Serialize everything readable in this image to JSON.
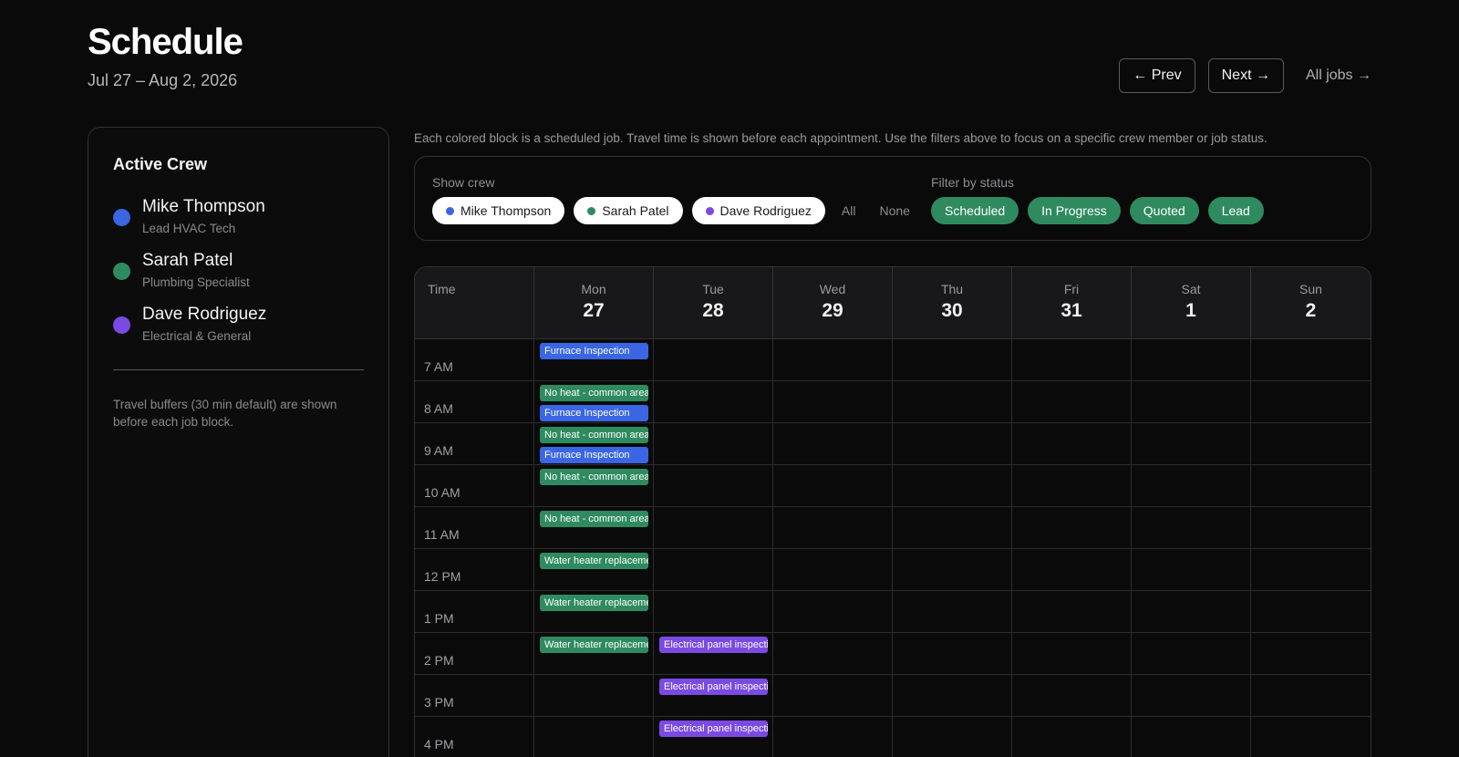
{
  "header": {
    "title": "Schedule",
    "subtitle": "Jul 27 – Aug 2, 2026",
    "prev_label": "← Prev",
    "next_label": "Next →",
    "all_jobs_label": "All jobs →"
  },
  "crew_panel": {
    "title": "Active Crew",
    "members": [
      {
        "name": "Mike Thompson",
        "role": "Lead HVAC Tech",
        "color": "#3a66e3"
      },
      {
        "name": "Sarah Patel",
        "role": "Plumbing Specialist",
        "color": "#2f8b5f"
      },
      {
        "name": "Dave Rodriguez",
        "role": "Electrical & General",
        "color": "#7a4ae2"
      }
    ],
    "note": "Travel buffers (30 min default) are shown before each job block."
  },
  "help_text": "Each colored block is a scheduled job. Travel time is shown before each appointment. Use the filters above to focus on a specific crew member or job status.",
  "filters": {
    "crew_label": "Show crew",
    "crew_pills": [
      {
        "label": "Mike Thompson",
        "color": "#3a66e3"
      },
      {
        "label": "Sarah Patel",
        "color": "#2f8b5f"
      },
      {
        "label": "Dave Rodriguez",
        "color": "#7a4ae2"
      }
    ],
    "all_label": "All",
    "none_label": "None",
    "status_label": "Filter by status",
    "status_pills": [
      "Scheduled",
      "In Progress",
      "Quoted",
      "Lead"
    ]
  },
  "calendar": {
    "time_header": "Time",
    "days": [
      {
        "name": "Mon",
        "num": "27"
      },
      {
        "name": "Tue",
        "num": "28"
      },
      {
        "name": "Wed",
        "num": "29"
      },
      {
        "name": "Thu",
        "num": "30"
      },
      {
        "name": "Fri",
        "num": "31"
      },
      {
        "name": "Sat",
        "num": "1"
      },
      {
        "name": "Sun",
        "num": "2"
      }
    ],
    "times": [
      "7 AM",
      "8 AM",
      "9 AM",
      "10 AM",
      "11 AM",
      "12 PM",
      "1 PM",
      "2 PM",
      "3 PM",
      "4 PM"
    ],
    "events": [
      {
        "day": 0,
        "row": 0,
        "slot": 0,
        "label": "Furnace Inspection",
        "color": "#3a66e3"
      },
      {
        "day": 0,
        "row": 1,
        "slot": 0,
        "label": "No heat - common area f",
        "color": "#2f8b5f"
      },
      {
        "day": 0,
        "row": 1,
        "slot": 1,
        "label": "Furnace Inspection",
        "color": "#3a66e3"
      },
      {
        "day": 0,
        "row": 2,
        "slot": 0,
        "label": "No heat - common area f",
        "color": "#2f8b5f"
      },
      {
        "day": 0,
        "row": 2,
        "slot": 1,
        "label": "Furnace Inspection",
        "color": "#3a66e3"
      },
      {
        "day": 0,
        "row": 3,
        "slot": 0,
        "label": "No heat - common area f",
        "color": "#2f8b5f"
      },
      {
        "day": 0,
        "row": 4,
        "slot": 0,
        "label": "No heat - common area f",
        "color": "#2f8b5f"
      },
      {
        "day": 0,
        "row": 5,
        "slot": 0,
        "label": "Water heater replacemen",
        "color": "#2f8b5f"
      },
      {
        "day": 0,
        "row": 6,
        "slot": 0,
        "label": "Water heater replacemen",
        "color": "#2f8b5f"
      },
      {
        "day": 0,
        "row": 7,
        "slot": 0,
        "label": "Water heater replacemen",
        "color": "#2f8b5f"
      },
      {
        "day": 1,
        "row": 7,
        "slot": 0,
        "label": "Electrical panel inspectio",
        "color": "#7a4ae2"
      },
      {
        "day": 1,
        "row": 8,
        "slot": 0,
        "label": "Electrical panel inspectio",
        "color": "#7a4ae2"
      },
      {
        "day": 1,
        "row": 9,
        "slot": 0,
        "label": "Electrical panel inspectio",
        "color": "#7a4ae2"
      }
    ]
  }
}
